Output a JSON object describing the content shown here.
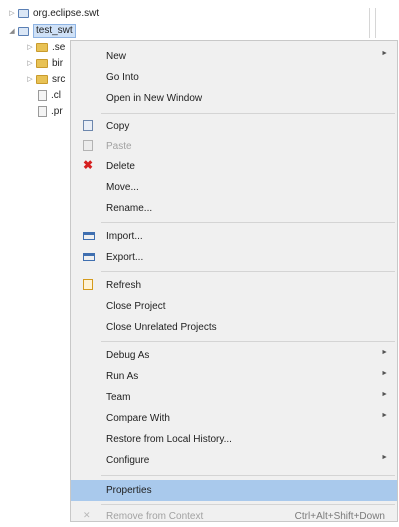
{
  "tree": {
    "items": [
      {
        "label": "org.eclipse.swt",
        "arrow": "▷",
        "icon": "project-icon"
      },
      {
        "label": "test_swt",
        "arrow": "◢",
        "icon": "project-icon"
      },
      {
        "label": ".se",
        "arrow": "▷",
        "icon": "folder-icon"
      },
      {
        "label": "bir",
        "arrow": "▷",
        "icon": "folder-icon"
      },
      {
        "label": "src",
        "arrow": "▷",
        "icon": "folder-icon"
      },
      {
        "label": ".cl",
        "icon": "file-icon"
      },
      {
        "label": ".pr",
        "icon": "file-icon"
      }
    ]
  },
  "menu": {
    "items": [
      {
        "label": "New",
        "submenu": "►"
      },
      {
        "label": "Go Into"
      },
      {
        "label": "Open in New Window"
      },
      {
        "label": "Copy",
        "icon": "copy-icon"
      },
      {
        "label": "Paste",
        "icon": "paste-icon",
        "disabled": true
      },
      {
        "label": "Delete",
        "icon": "delete-icon",
        "glyph": "✖"
      },
      {
        "label": "Move..."
      },
      {
        "label": "Rename..."
      },
      {
        "label": "Import...",
        "icon": "import-icon"
      },
      {
        "label": "Export...",
        "icon": "export-icon"
      },
      {
        "label": "Refresh",
        "icon": "refresh-icon"
      },
      {
        "label": "Close Project"
      },
      {
        "label": "Close Unrelated Projects"
      },
      {
        "label": "Debug As",
        "submenu": "►"
      },
      {
        "label": "Run As",
        "submenu": "►"
      },
      {
        "label": "Team",
        "submenu": "►"
      },
      {
        "label": "Compare With",
        "submenu": "►"
      },
      {
        "label": "Restore from Local History..."
      },
      {
        "label": "Configure",
        "submenu": "►"
      },
      {
        "label": "Properties",
        "selected": true
      },
      {
        "label": "Remove from Context",
        "icon": "remove-from-context-icon",
        "glyph": "✕",
        "shortcut": "Ctrl+Alt+Shift+Down",
        "disabled": true
      }
    ]
  }
}
